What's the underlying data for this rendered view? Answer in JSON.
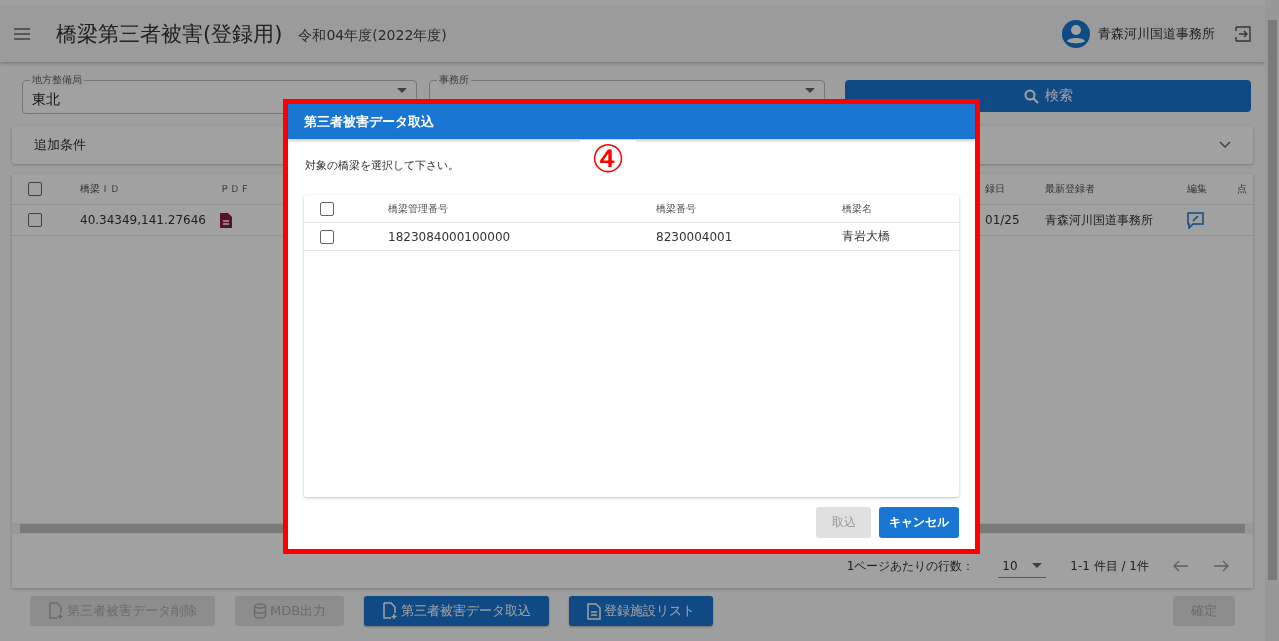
{
  "header": {
    "title": "橋梁第三者被害(登録用)",
    "fiscal_year": "令和04年度(2022年度)",
    "user": "青森河川国道事務所"
  },
  "filters": [
    {
      "label": "地方整備局",
      "value": "東北"
    },
    {
      "label": "事務所"
    }
  ],
  "search_button": "検索",
  "additional_conditions": {
    "label": "追加条件",
    "expanded": false
  },
  "table": {
    "columns": [
      "橋梁ＩＤ",
      "ＰＤＦ",
      "録日",
      "最新登録者",
      "編集",
      "点"
    ],
    "rows": [
      {
        "checked": false,
        "id": "40.34349,141.27646",
        "date": "01/25",
        "registrant": "青森河川国道事務所"
      }
    ],
    "select_all_checked": false
  },
  "pagination": {
    "rows_per_page_label": "1ページあたりの行数：",
    "rows_per_page": "10",
    "range": "1-1 件目 / 1件"
  },
  "actions": [
    {
      "kind": "delete",
      "label": "第三者被害データ削除",
      "disabled": true
    },
    {
      "kind": "database",
      "label": "MDB出力",
      "disabled": true
    },
    {
      "kind": "import",
      "label": "第三者被害データ取込",
      "disabled": false
    },
    {
      "kind": "list",
      "label": "登録施設リスト",
      "disabled": false
    }
  ],
  "confirm_button": {
    "label": "確定",
    "disabled": true
  },
  "dialog": {
    "title": "第三者被害データ取込",
    "instruction": "対象の橋梁を選択して下さい。",
    "select_all_checked": false,
    "columns": [
      "橋梁管理番号",
      "橋梁番号",
      "橋梁名"
    ],
    "rows": [
      {
        "checked": false,
        "cells": [
          "1823084000100000",
          "8230004001",
          "青岩大橋"
        ]
      }
    ],
    "buttons": [
      {
        "kind": "import",
        "label": "取込",
        "disabled": true
      },
      {
        "kind": "cancel",
        "label": "キャンセル",
        "disabled": false
      }
    ]
  },
  "annotation": {
    "label": "④"
  }
}
